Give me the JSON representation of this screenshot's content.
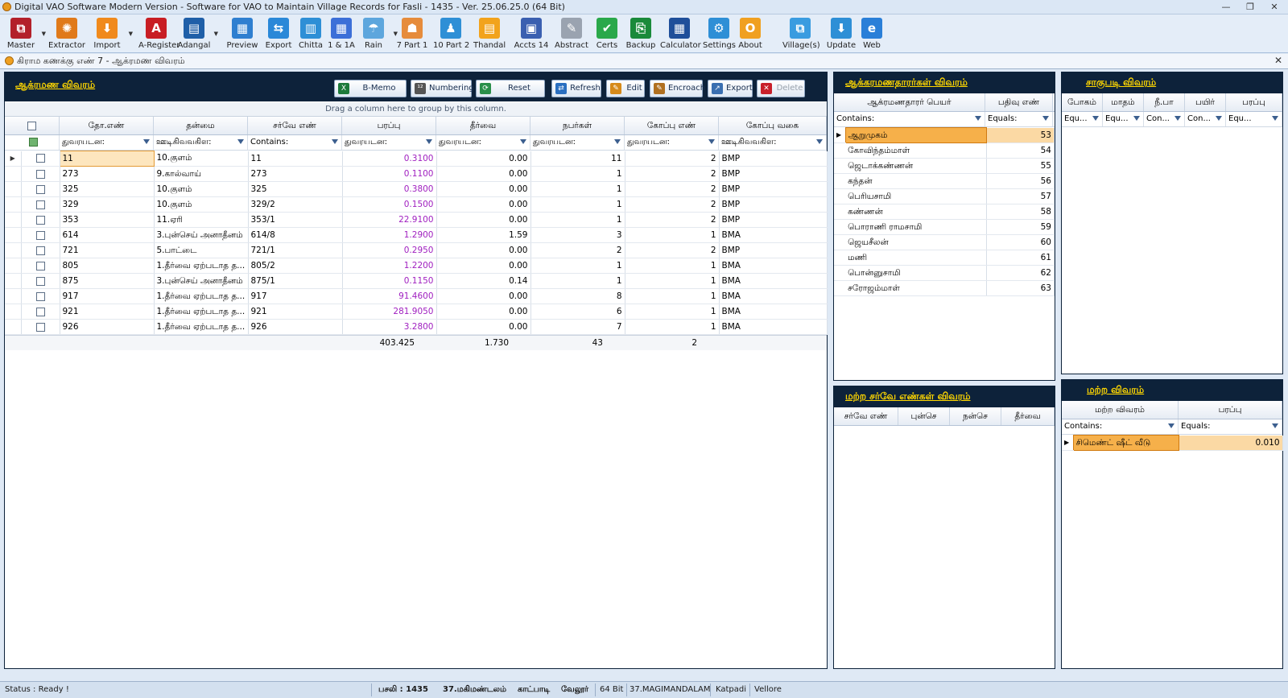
{
  "window": {
    "title": "Digital VAO Software Modern Version - Software for VAO to Maintain Village Records for Fasli - 1435 - Ver. 25.06.25.0 (64 Bit)"
  },
  "toolbar": [
    {
      "label": "Master",
      "icon": "master-icon",
      "color": "#b3202a",
      "glyph": "⧉",
      "dd": true
    },
    {
      "label": "Extractor",
      "icon": "extractor-icon",
      "color": "#e07a1a",
      "glyph": "✺",
      "dd": false
    },
    {
      "label": "Import",
      "icon": "import-icon",
      "color": "#f08a1c",
      "glyph": "⬇",
      "dd": true
    },
    {
      "label": "A-Register",
      "icon": "a-register-icon",
      "color": "#c81e24",
      "glyph": "A",
      "dd": false
    },
    {
      "label": "Adangal",
      "icon": "adangal-icon",
      "color": "#1f5fa8",
      "glyph": "▤",
      "dd": true
    },
    {
      "label": "Preview",
      "icon": "preview-icon",
      "color": "#2f7fd0",
      "glyph": "▦",
      "dd": false
    },
    {
      "label": "Export",
      "icon": "export-icon",
      "color": "#2a88d8",
      "glyph": "⇆",
      "dd": false
    },
    {
      "label": "Chitta",
      "icon": "chitta-icon",
      "color": "#2e8fd6",
      "glyph": "▥",
      "dd": false
    },
    {
      "label": "1 & 1A",
      "icon": "one-and-one-a-icon",
      "color": "#3c6fd8",
      "glyph": "▦",
      "dd": false
    },
    {
      "label": "Rain",
      "icon": "rain-icon",
      "color": "#5da6dd",
      "glyph": "☂",
      "dd": true
    },
    {
      "label": "7 Part 1",
      "icon": "seven-part-one-icon",
      "color": "#e68c3c",
      "glyph": "☗",
      "dd": false
    },
    {
      "label": "10 Part 2",
      "icon": "ten-part-two-icon",
      "color": "#2e8fd6",
      "glyph": "♟",
      "dd": false
    },
    {
      "label": "Thandal",
      "icon": "thandal-icon",
      "color": "#f2a31c",
      "glyph": "▤",
      "dd": false
    },
    {
      "label": "Accts 14",
      "icon": "accts-fourteen-icon",
      "color": "#3a5fb0",
      "glyph": "▣",
      "dd": false
    },
    {
      "label": "Abstract",
      "icon": "abstract-icon",
      "color": "#9aa3b0",
      "glyph": "✎",
      "dd": false
    },
    {
      "label": "Certs",
      "icon": "certs-icon",
      "color": "#2aa84a",
      "glyph": "✔",
      "dd": false
    },
    {
      "label": "Backup",
      "icon": "backup-icon",
      "color": "#1a8a3a",
      "glyph": "⎘",
      "dd": false
    },
    {
      "label": "Calculator",
      "icon": "calculator-icon",
      "color": "#1f4f9a",
      "glyph": "▦",
      "dd": false
    },
    {
      "label": "Settings",
      "icon": "settings-icon",
      "color": "#2e8fd6",
      "glyph": "⚙",
      "dd": false
    },
    {
      "label": "About",
      "icon": "about-icon",
      "color": "#f0a020",
      "glyph": "O",
      "dd": false
    },
    {
      "label": "Village(s)",
      "icon": "villages-icon",
      "color": "#3a9ce0",
      "glyph": "⧉",
      "dd": false
    },
    {
      "label": "Update",
      "icon": "update-icon",
      "color": "#2e8fd6",
      "glyph": "⬇",
      "dd": false
    },
    {
      "label": "Web",
      "icon": "web-icon",
      "color": "#2a7fd8",
      "glyph": "e",
      "dd": false
    }
  ],
  "doc_tab": {
    "title": "கிராம கணக்கு எண் 7 - ஆக்ரமண விவரம்"
  },
  "main": {
    "title": "ஆக்ரமண விவரம்",
    "buttons": [
      {
        "label": "B-Memo",
        "icon": "excel-icon"
      },
      {
        "label": "Numbering",
        "icon": "numbering-icon"
      },
      {
        "label": "Reset",
        "icon": "reset-icon"
      },
      {
        "label": "Refresh",
        "icon": "refresh-icon"
      },
      {
        "label": "Edit",
        "icon": "edit-icon"
      },
      {
        "label": "Encroach",
        "icon": "encroach-icon"
      },
      {
        "label": "Export",
        "icon": "export-icon"
      },
      {
        "label": "Delete",
        "icon": "delete-icon"
      }
    ],
    "group_hint": "Drag a column here to group by this column.",
    "columns": [
      "தோ.எண்",
      "தன்மை",
      "சர்வே எண்",
      "பரப்பு",
      "தீர்வை",
      "நபர்கள்",
      "கோப்பு எண்",
      "கோப்பு வகை"
    ],
    "filters": [
      "துவரயடன:",
      "ஊடிகிவவகிள:",
      "Contains:",
      "துவரயடன:",
      "துவரயடன:",
      "துவரயடன:",
      "துவரயடன:",
      "ஊடிகிவவகிள:"
    ],
    "rows": [
      [
        "11",
        "10.குளம்",
        "11",
        "0.3100",
        "0.00",
        "11",
        "2",
        "BMP"
      ],
      [
        "273",
        "9.கால்வாய்",
        "273",
        "0.1100",
        "0.00",
        "1",
        "2",
        "BMP"
      ],
      [
        "325",
        "10.குளம்",
        "325",
        "0.3800",
        "0.00",
        "1",
        "2",
        "BMP"
      ],
      [
        "329",
        "10.குளம்",
        "329/2",
        "0.1500",
        "0.00",
        "1",
        "2",
        "BMP"
      ],
      [
        "353",
        "11.ஏரி",
        "353/1",
        "22.9100",
        "0.00",
        "1",
        "2",
        "BMP"
      ],
      [
        "614",
        "3.புன்செய் அனாதீனம்",
        "614/8",
        "1.2900",
        "1.59",
        "3",
        "1",
        "BMA"
      ],
      [
        "721",
        "5.பாட்டை",
        "721/1",
        "0.2950",
        "0.00",
        "2",
        "2",
        "BMP"
      ],
      [
        "805",
        "1.தீர்வை ஏற்படாத த...",
        "805/2",
        "1.2200",
        "0.00",
        "1",
        "1",
        "BMA"
      ],
      [
        "875",
        "3.புன்செய் அனாதீனம்",
        "875/1",
        "0.1150",
        "0.14",
        "1",
        "1",
        "BMA"
      ],
      [
        "917",
        "1.தீர்வை ஏற்படாத த...",
        "917",
        "91.4600",
        "0.00",
        "8",
        "1",
        "BMA"
      ],
      [
        "921",
        "1.தீர்வை ஏற்படாத த...",
        "921",
        "281.9050",
        "0.00",
        "6",
        "1",
        "BMA"
      ],
      [
        "926",
        "1.தீர்வை ஏற்படாத த...",
        "926",
        "3.2800",
        "0.00",
        "7",
        "1",
        "BMA"
      ]
    ],
    "totals": {
      "area": "403.425",
      "tax": "1.730",
      "persons": "43",
      "file": "2"
    }
  },
  "encroachers": {
    "title": "ஆக்கரமணதாரர்கள் விவரம்",
    "columns": [
      "ஆக்ரமணதாரர் பெயர்",
      "பதிவு எண்"
    ],
    "filters": [
      "Contains:",
      "Equals:"
    ],
    "rows": [
      [
        "ஆறுமுகம்",
        "53"
      ],
      [
        "கோவிந்தம்மாள்",
        "54"
      ],
      [
        "ஜெடாக்கண்ணன்",
        "55"
      ],
      [
        "கந்தன்",
        "56"
      ],
      [
        "பெரியசாமி",
        "57"
      ],
      [
        "கண்ணன்",
        "58"
      ],
      [
        "பொராணி ராமசாமி",
        "59"
      ],
      [
        "ஜெயசீலன்",
        "60"
      ],
      [
        "மணி",
        "61"
      ],
      [
        "பொன்னுசாமி",
        "62"
      ],
      [
        "சரோஜம்மாள்",
        "63"
      ]
    ]
  },
  "cultivation": {
    "title": "சாகுபடி விவரம்",
    "columns": [
      "போகம்",
      "மாதம்",
      "நீ.பா",
      "பயிர்",
      "பரப்பு"
    ],
    "filters": [
      "Equ...",
      "Equ...",
      "Con...",
      "Con...",
      "Equ..."
    ]
  },
  "other_survey": {
    "title": "மற்ற சர்வே எண்கள் விவரம்",
    "columns": [
      "சர்வே எண்",
      "புன்செ",
      "நன்செ",
      "தீர்வை"
    ]
  },
  "other_details": {
    "title": "மற்ற விவரம்",
    "columns": [
      "மற்ற விவரம்",
      "பரப்பு"
    ],
    "filters": [
      "Contains:",
      "Equals:"
    ],
    "rows": [
      [
        "சிமெண்ட் ஷீட் வீடு",
        "0.010"
      ]
    ]
  },
  "status": {
    "text": "Status : Ready !",
    "fasli": "பசலி : 1435",
    "village_ta": "37.மகிமண்டலம்",
    "taluk_ta": "காட்பாடி",
    "district_ta": "வேலூர்",
    "bits": "64 Bit",
    "village": "37.MAGIMANDALAM",
    "taluk": "Katpadi",
    "district": "Vellore"
  }
}
